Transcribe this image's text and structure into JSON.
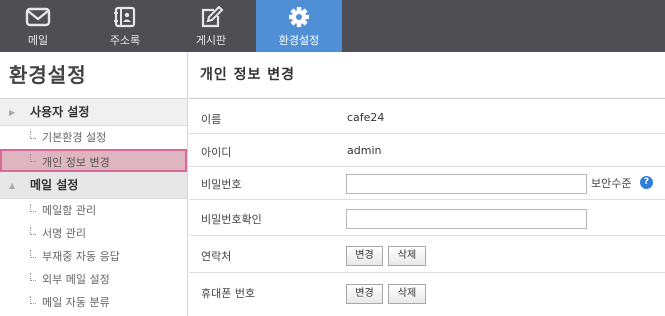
{
  "nav": {
    "items": [
      {
        "label": "메일",
        "icon": "mail-icon"
      },
      {
        "label": "주소록",
        "icon": "address-book-icon"
      },
      {
        "label": "게시판",
        "icon": "board-edit-icon"
      },
      {
        "label": "환경설정",
        "icon": "gear-icon"
      }
    ],
    "active_index": 3
  },
  "sidebar": {
    "title": "환경설정",
    "sections": [
      {
        "label": "사용자 설정",
        "items": [
          "기본환경 설정",
          "개인 정보 변경"
        ]
      },
      {
        "label": "메일 설정",
        "items": [
          "메일함 관리",
          "서명 관리",
          "부재중 자동 응답",
          "외부 메일 설정",
          "메일 자동 분류"
        ]
      }
    ],
    "selected_item": "개인 정보 변경"
  },
  "main": {
    "title": "개인 정보 변경",
    "fields": {
      "name": {
        "label": "이름",
        "value": "cafe24"
      },
      "id": {
        "label": "아이디",
        "value": "admin"
      },
      "password": {
        "label": "비밀번호",
        "value": "",
        "security_label": "보안수준",
        "help": "?"
      },
      "password_confirm": {
        "label": "비밀번호확인",
        "value": ""
      },
      "contact": {
        "label": "연락처",
        "change": "변경",
        "delete": "삭제"
      },
      "mobile": {
        "label": "휴대폰 번호",
        "change": "변경",
        "delete": "삭제"
      }
    }
  },
  "colors": {
    "nav_bg": "#4f4f53",
    "nav_active": "#4e8fd6",
    "selected_bg": "#dfb6c0",
    "selected_border": "#d86a9a",
    "help_icon": "#2e7fd6"
  }
}
